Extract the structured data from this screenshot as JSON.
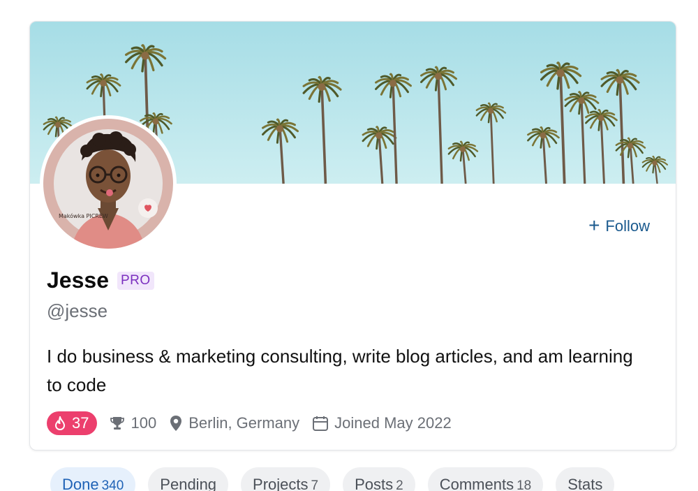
{
  "profile": {
    "name": "Jesse",
    "badge": "PRO",
    "handle": "@jesse",
    "bio": "I do business & marketing consulting, write blog articles, and am learning to code",
    "avatar_caption": "Makówka PICREW",
    "follow_label": "Follow"
  },
  "stats": {
    "streak": "37",
    "trophies": "100",
    "location": "Berlin, Germany",
    "joined": "Joined May 2022"
  },
  "icons": {
    "follow": "plus-icon",
    "streak": "flame-icon",
    "trophies": "trophy-icon",
    "location": "location-pin-icon",
    "joined": "calendar-icon"
  },
  "tabs": [
    {
      "label": "Done",
      "count": "340",
      "active": true
    },
    {
      "label": "Pending",
      "count": "",
      "active": false
    },
    {
      "label": "Projects",
      "count": "7",
      "active": false
    },
    {
      "label": "Posts",
      "count": "2",
      "active": false
    },
    {
      "label": "Comments",
      "count": "18",
      "active": false
    },
    {
      "label": "Stats",
      "count": "",
      "active": false
    }
  ],
  "colors": {
    "accent": "#1b5a8e",
    "streak": "#ec3f6d",
    "pro_text": "#7b2fbf",
    "pro_bg": "#f1e6fb",
    "active_tab_bg": "#e6f0fc",
    "active_tab_text": "#1f62b6"
  }
}
